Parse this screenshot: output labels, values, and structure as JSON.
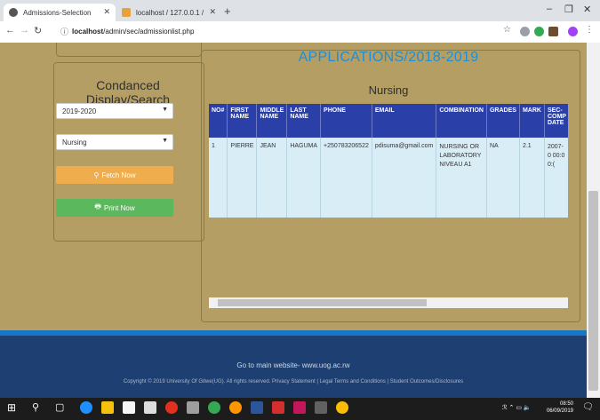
{
  "browser": {
    "tabs": [
      {
        "label": "Admissions-Selection"
      },
      {
        "label": "localhost / 127.0.0.1 / ispgac_isp"
      }
    ],
    "url_host": "localhost",
    "url_path": "/admin/sec/admissionlist.php"
  },
  "sidebar": {
    "title": "Condanced Display/Search",
    "year_select": "2019-2020",
    "program_select": "Nursing",
    "fetch_label": "Fetch Now",
    "print_label": "Print Now"
  },
  "main": {
    "title": "APPLICATIONS/2018-2019",
    "program": "Nursing"
  },
  "table": {
    "headers": [
      "NO#",
      "FIRST NAME",
      "MIDDLE NAME",
      "LAST NAME",
      "PHONE",
      "EMAIL",
      "COMBINATION",
      "GRADES",
      "MARK",
      "SEC-COMP DATE"
    ],
    "rows": [
      [
        "1",
        "PIERRE",
        "JEAN",
        "HAGUMA",
        "+250783206522",
        "pdisuma@gmail.com",
        "NURSING OR LABORATORY NIVEAU A1",
        "NA",
        "2.1",
        "2007-0 00:00:("
      ]
    ]
  },
  "footer": {
    "link": "Go to main website- www.uog.ac.rw",
    "copyright": "Copyright © 2019 University Of Gitwe(UG). All rights reserved. Privacy Statement | Legal Terms and Conditions | Student Outcomes/Disclosures"
  },
  "taskbar": {
    "time": "08:50",
    "date": "06/09/2019"
  },
  "colors": {
    "page_bg": "#b59e63",
    "title_blue": "#1e8fd6",
    "header_blue": "#2b3fa8",
    "fetch_orange": "#f0ad4e",
    "print_green": "#5cb85c",
    "footer_navy": "#1d3f72"
  }
}
